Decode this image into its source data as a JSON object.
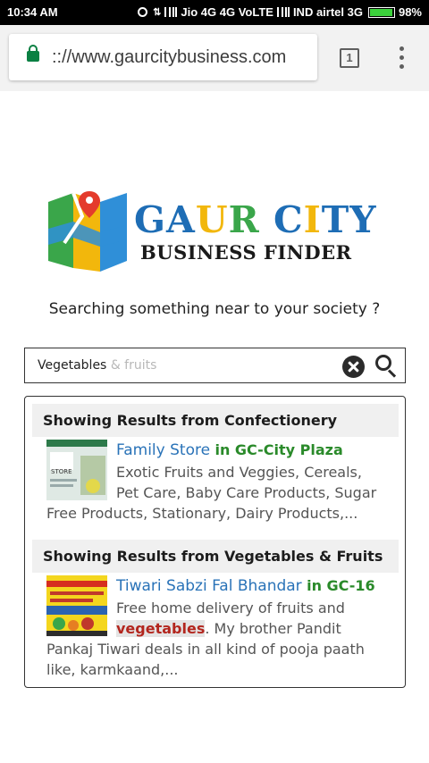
{
  "status_bar": {
    "time": "10:34 AM",
    "carrier1": "Jio 4G 4G VoLTE",
    "carrier2": "IND airtel 3G",
    "battery": "98%",
    "battery_level": 0.98
  },
  "browser": {
    "url": ":://www.gaurcitybusiness.com",
    "tab_count": "1"
  },
  "brand": {
    "title": "GAUR CITY",
    "subtitle": "BUSINESS FINDER",
    "colors": {
      "blue": "#1e6db5",
      "gold": "#f2b70c",
      "green": "#3aa64a"
    }
  },
  "tagline": "Searching something near to your society ?",
  "search": {
    "value": "Vegetables",
    "placeholder_suffix": "& fruits"
  },
  "sections": [
    {
      "heading": "Showing Results from Confectionery",
      "item": {
        "name": "Family Store",
        "location": "in GC-City Plaza",
        "thumb_caption": "STORE",
        "desc_lines": [
          "Exotic Fruits and Veggies, Cereals,",
          "Pet Care, Baby Care Products, Sugar",
          "Free Products, Stationary, Dairy Products,..."
        ]
      }
    },
    {
      "heading": "Showing Results from Vegetables & Fruits",
      "item": {
        "name": "Tiwari Sabzi Fal Bhandar",
        "location": "in GC-16",
        "desc_line1": "Free home delivery of fruits and",
        "highlight": "vegetables",
        "desc_line2_rest": ". My brother Pandit",
        "desc_line3": "Pankaj Tiwari deals in all kind of pooja paath",
        "desc_line4": "like, karmkaand,..."
      }
    }
  ]
}
